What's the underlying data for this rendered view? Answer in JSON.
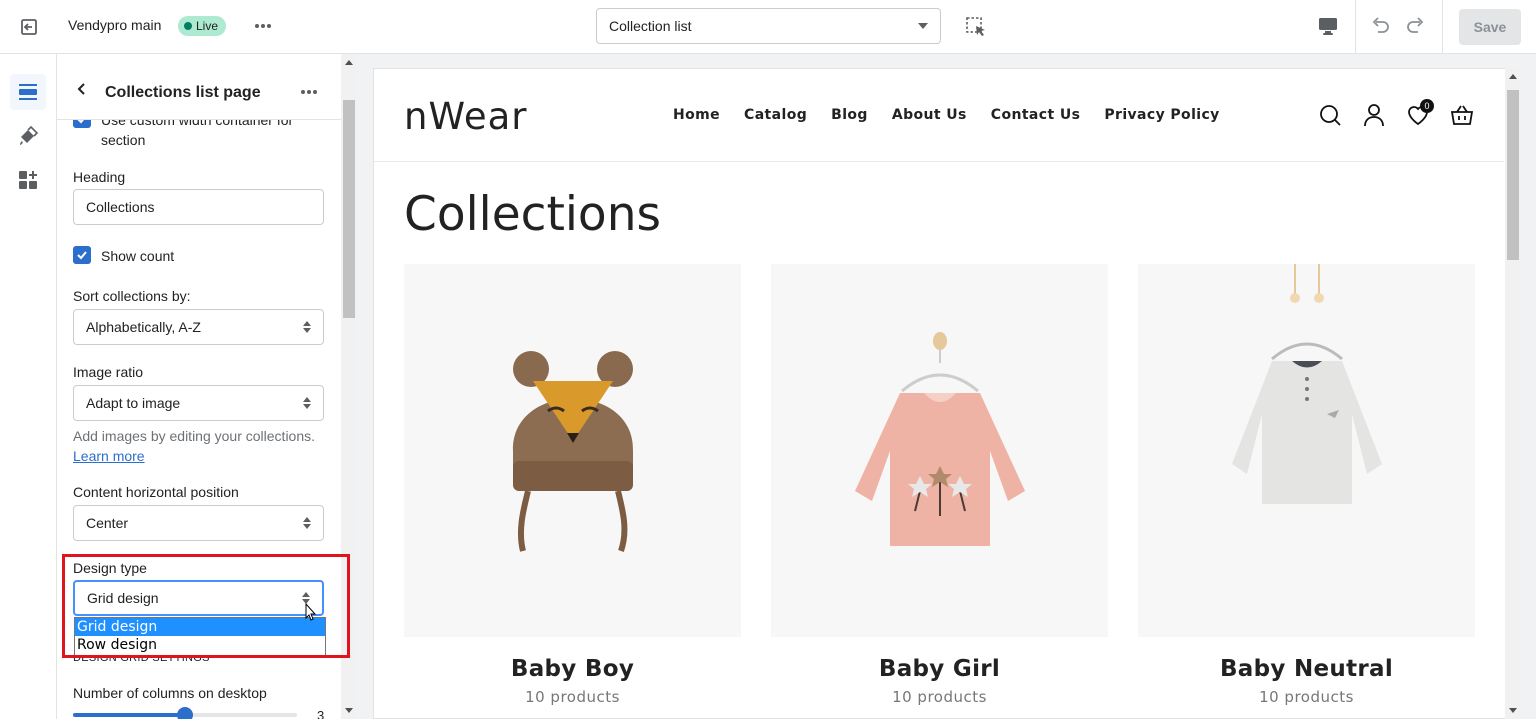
{
  "topbar": {
    "store_name": "Vendypro main",
    "live_label": "Live",
    "template_select_value": "Collection list",
    "save_label": "Save"
  },
  "rail": {
    "items": [
      "sections-icon",
      "theme-settings-icon",
      "apps-icon"
    ]
  },
  "panel": {
    "title": "Collections list page",
    "custom_width_label": "Use custom width container for section",
    "heading_label": "Heading",
    "heading_value": "Collections",
    "show_count_label": "Show count",
    "sort_label": "Sort collections by:",
    "sort_value": "Alphabetically, A-Z",
    "image_ratio_label": "Image ratio",
    "image_ratio_value": "Adapt to image",
    "helper_text": "Add images by editing your collections.",
    "learn_more": "Learn more",
    "content_position_label": "Content horizontal position",
    "content_position_value": "Center",
    "design_type_label": "Design type",
    "design_type_value": "Grid design",
    "design_type_options": [
      "Grid design",
      "Row design"
    ],
    "grid_settings_caption": "DESIGN GRID SETTINGS",
    "columns_label": "Number of columns on desktop",
    "columns_value": "3",
    "columns_fraction": 0.5
  },
  "preview": {
    "logo": "nWear",
    "nav": [
      "Home",
      "Catalog",
      "Blog",
      "About Us",
      "Contact Us",
      "Privacy Policy"
    ],
    "wishlist_count": "0",
    "page_heading": "Collections",
    "collections": [
      {
        "title": "Baby Boy",
        "count": "10 products"
      },
      {
        "title": "Baby Girl",
        "count": "10 products"
      },
      {
        "title": "Baby Neutral",
        "count": "10 products"
      }
    ]
  },
  "colors": {
    "accent": "#2c6ecb",
    "live_badge": "#aee9d1",
    "highlight": "#e0141c",
    "dropdown_selected": "#1e90ff"
  }
}
